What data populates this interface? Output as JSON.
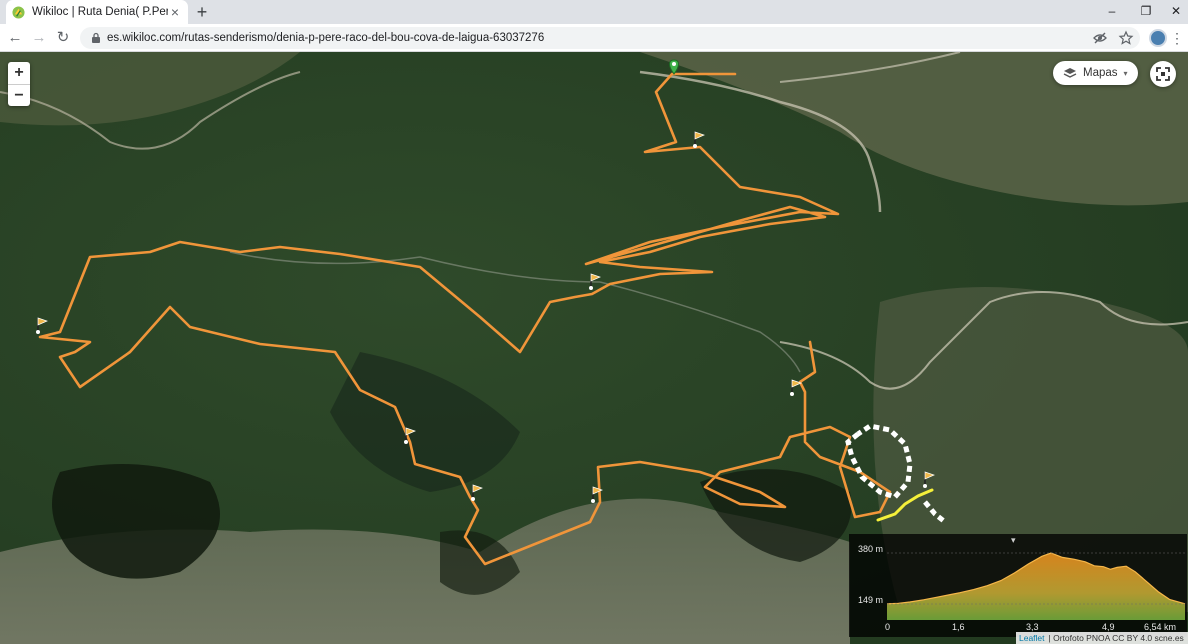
{
  "browser": {
    "tab_title": "Wikiloc | Ruta Denia( P.Pere raco",
    "tab_close": "×",
    "new_tab": "+",
    "window_controls": {
      "minimize": "–",
      "maximize": "❐",
      "close": "✕"
    },
    "url": "es.wikiloc.com/rutas-senderismo/denia-p-pere-raco-del-bou-cova-de-laigua-63037276",
    "nav": {
      "back": "←",
      "forward": "→",
      "reload": "↻"
    },
    "toolbar_icons": [
      "eye-off-icon",
      "star-icon"
    ],
    "menu": "⋮"
  },
  "map": {
    "zoom_in": "+",
    "zoom_out": "−",
    "layers_label": "Mapas",
    "layers_caret": "▾",
    "track_color": "#f0953a",
    "highlight_color": "#f5f03a",
    "waypoint_icon": "flag-icon",
    "start_icon": "green-pin-icon"
  },
  "elevation": {
    "collapse": "▾",
    "max_label": "380 m",
    "min_label": "149 m",
    "x_labels": [
      "0",
      "1,6",
      "3,3",
      "4,9",
      "6,54 km"
    ],
    "max_m": 380,
    "min_m": 149,
    "distance_km": 6.54,
    "profile_m": [
      [
        0,
        150
      ],
      [
        0.25,
        152
      ],
      [
        0.5,
        158
      ],
      [
        0.8,
        168
      ],
      [
        1.1,
        180
      ],
      [
        1.4,
        192
      ],
      [
        1.6,
        200
      ],
      [
        1.9,
        214
      ],
      [
        2.2,
        232
      ],
      [
        2.5,
        255
      ],
      [
        2.8,
        290
      ],
      [
        3.1,
        330
      ],
      [
        3.4,
        365
      ],
      [
        3.6,
        380
      ],
      [
        3.85,
        360
      ],
      [
        4.1,
        352
      ],
      [
        4.35,
        340
      ],
      [
        4.55,
        322
      ],
      [
        4.75,
        318
      ],
      [
        4.9,
        306
      ],
      [
        5.05,
        315
      ],
      [
        5.25,
        320
      ],
      [
        5.45,
        295
      ],
      [
        5.7,
        250
      ],
      [
        5.95,
        205
      ],
      [
        6.2,
        170
      ],
      [
        6.54,
        150
      ]
    ]
  },
  "attribution": {
    "leaflet": "Leaflet",
    "text": "| Ortofoto PNOA CC BY 4.0 scne.es"
  }
}
